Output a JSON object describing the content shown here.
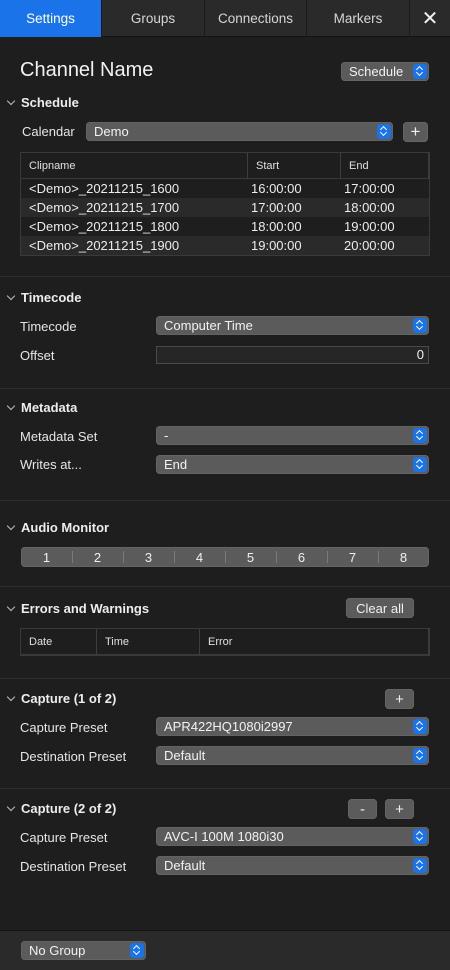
{
  "tabs": [
    "Settings",
    "Groups",
    "Connections",
    "Markers"
  ],
  "close_glyph": "✕",
  "channel_name": "Channel Name",
  "mode_select": "Schedule",
  "schedule": {
    "heading": "Schedule",
    "calendar_label": "Calendar",
    "calendar_value": "Demo",
    "add_glyph": "+",
    "columns": [
      "Clipname",
      "Start",
      "End"
    ],
    "rows": [
      {
        "clipname": "<Demo>_20211215_1600",
        "start": "16:00:00",
        "end": "17:00:00"
      },
      {
        "clipname": "<Demo>_20211215_1700",
        "start": "17:00:00",
        "end": "18:00:00"
      },
      {
        "clipname": "<Demo>_20211215_1800",
        "start": "18:00:00",
        "end": "19:00:00"
      },
      {
        "clipname": "<Demo>_20211215_1900",
        "start": "19:00:00",
        "end": "20:00:00"
      }
    ]
  },
  "timecode": {
    "heading": "Timecode",
    "timecode_label": "Timecode",
    "timecode_value": "Computer Time",
    "offset_label": "Offset",
    "offset_value": "0"
  },
  "metadata": {
    "heading": "Metadata",
    "set_label": "Metadata Set",
    "set_value": "-",
    "writes_label": "Writes at...",
    "writes_value": "End"
  },
  "audio": {
    "heading": "Audio Monitor",
    "channels": [
      "1",
      "2",
      "3",
      "4",
      "5",
      "6",
      "7",
      "8"
    ]
  },
  "errors": {
    "heading": "Errors and Warnings",
    "clear_label": "Clear all",
    "columns": [
      "Date",
      "Time",
      "Error"
    ]
  },
  "capture1": {
    "heading": "Capture (1 of 2)",
    "add_glyph": "+",
    "capture_label": "Capture Preset",
    "capture_value": "APR422HQ1080i2997",
    "dest_label": "Destination Preset",
    "dest_value": "Default"
  },
  "capture2": {
    "heading": "Capture (2 of 2)",
    "remove_glyph": "-",
    "add_glyph": "+",
    "capture_label": "Capture Preset",
    "capture_value": "AVC-I 100M 1080i30",
    "dest_label": "Destination Preset",
    "dest_value": "Default"
  },
  "footer": {
    "group_value": "No Group"
  },
  "colors": {
    "accent": "#1a73e8",
    "background": "#1e1e1e",
    "control": "#5b5b5b"
  }
}
